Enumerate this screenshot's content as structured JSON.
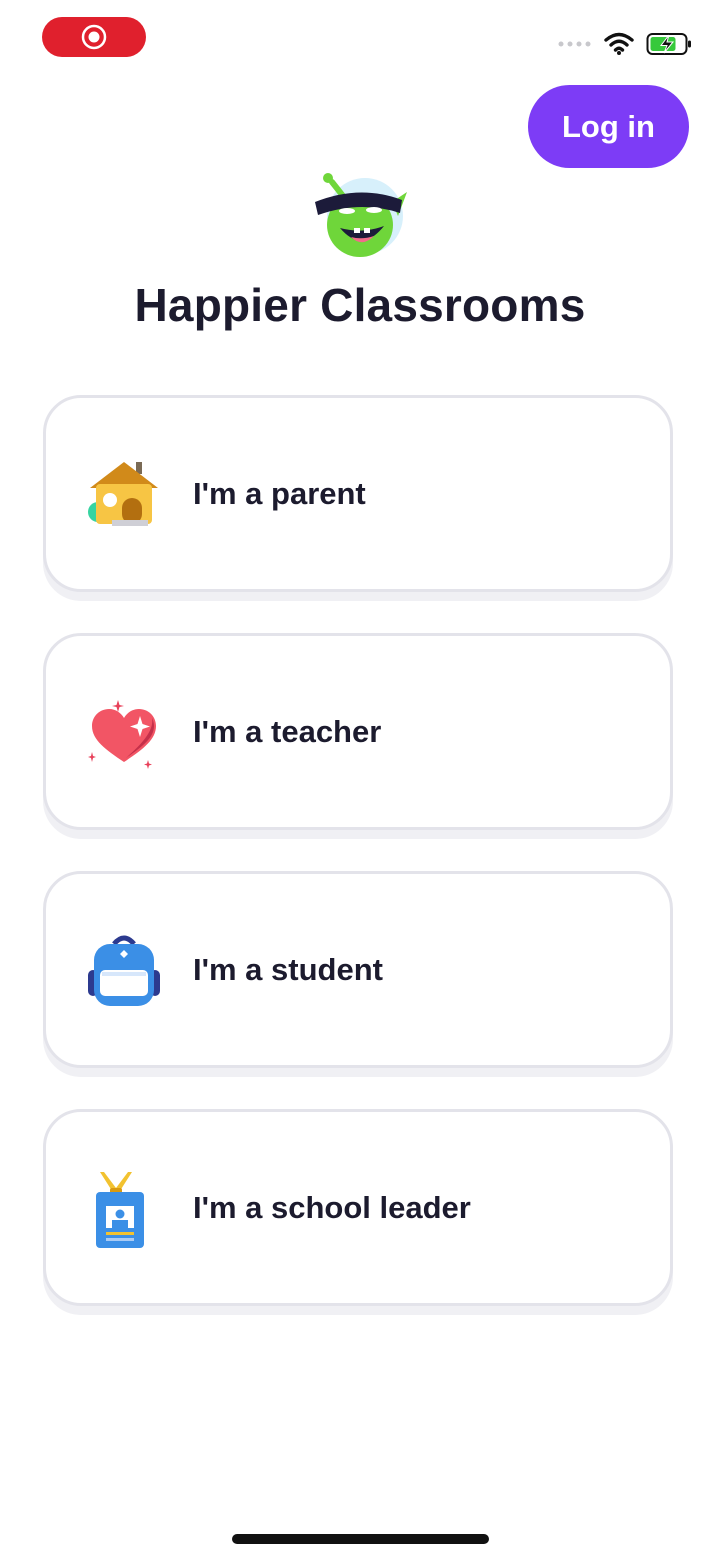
{
  "header": {
    "login_label": "Log in"
  },
  "hero": {
    "title": "Happier Classrooms"
  },
  "roles": [
    {
      "label": "I'm a parent",
      "icon": "house-icon"
    },
    {
      "label": "I'm a teacher",
      "icon": "heart-icon"
    },
    {
      "label": "I'm a student",
      "icon": "backpack-icon"
    },
    {
      "label": "I'm a school leader",
      "icon": "badge-icon"
    }
  ],
  "colors": {
    "accent": "#7d3cf6",
    "recording": "#e0202d",
    "text": "#1c1b2e",
    "battery_charge": "#36c93b"
  }
}
